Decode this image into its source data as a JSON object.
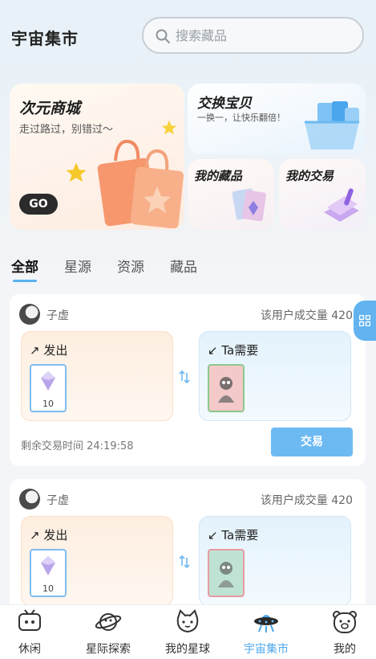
{
  "header": {
    "title": "宇宙集市",
    "search_placeholder": "搜索藏品",
    "search_icon": "search-icon"
  },
  "banners": {
    "mall": {
      "title": "次元商城",
      "subtitle": "走过路过，别错过～",
      "cta": "GO"
    },
    "exchange": {
      "title": "交换宝贝",
      "subtitle": "一换一，让快乐翻倍！"
    },
    "my_collection": {
      "title": "我的藏品"
    },
    "my_trades": {
      "title": "我的交易"
    }
  },
  "tabs": [
    {
      "label": "全部",
      "active": true
    },
    {
      "label": "星源",
      "active": false
    },
    {
      "label": "资源",
      "active": false
    },
    {
      "label": "藏品",
      "active": false
    }
  ],
  "trades": [
    {
      "user": "子虚",
      "volume": "该用户成交量 420",
      "give_label": "↗ 发出",
      "give_count": "10",
      "need_label": "↙ Ta需要",
      "timer": "剩余交易时间 24:19:58",
      "action": "交易"
    },
    {
      "user": "子虚",
      "volume": "该用户成交量 420",
      "give_label": "↗ 发出",
      "give_count": "10",
      "need_label": "↙ Ta需要"
    }
  ],
  "bottom_nav": [
    {
      "label": "休闲",
      "icon": "tv-icon",
      "active": false
    },
    {
      "label": "星际探索",
      "icon": "planet-icon",
      "active": false
    },
    {
      "label": "我的星球",
      "icon": "cat-face-icon",
      "active": false
    },
    {
      "label": "宇宙集市",
      "icon": "ufo-icon",
      "active": true
    },
    {
      "label": "我的",
      "icon": "bear-face-icon",
      "active": false
    }
  ],
  "colors": {
    "accent": "#5bb4f0",
    "active_nav": "#4ea8ec",
    "trade_button": "#6dbaf3",
    "give_box": "#fdeee0",
    "need_box": "#e3f2fc"
  }
}
